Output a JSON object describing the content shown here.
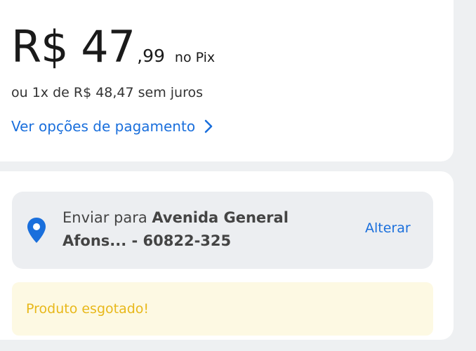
{
  "price": {
    "main": "R$ 47",
    "cents": ",99",
    "method": "no Pix",
    "installments": "ou 1x de R$ 48,47 sem juros",
    "payment_options_link": "Ver opções de pagamento"
  },
  "shipping": {
    "prefix": "Enviar para ",
    "address": "Avenida General Afons... - 60822-325",
    "change_label": "Alterar"
  },
  "status": {
    "message": "Produto esgotado!"
  },
  "icons": {
    "payment_chevron": "chevron-right-icon",
    "location": "location-pin-icon"
  },
  "colors": {
    "link": "#1a6fdc",
    "soldout_text": "#e8b81a",
    "soldout_bg": "#fdf9e3"
  }
}
